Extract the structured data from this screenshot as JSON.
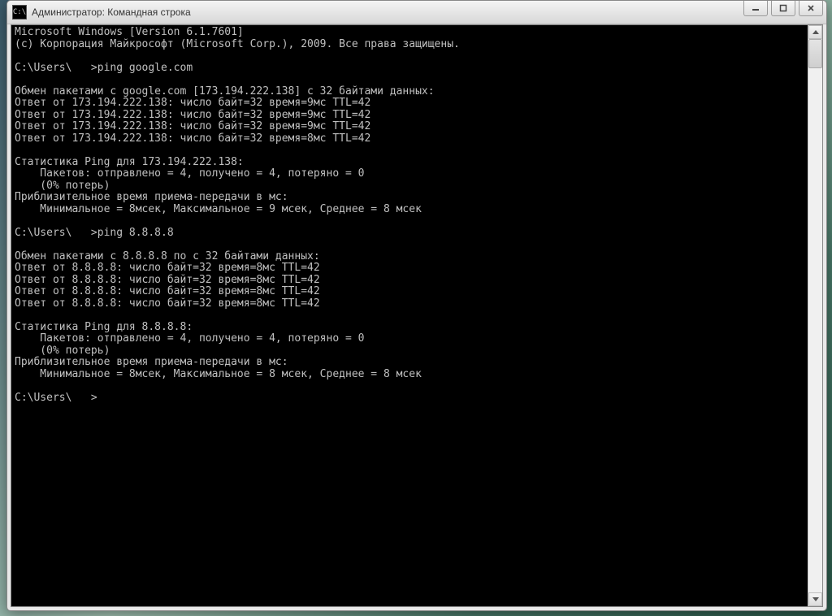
{
  "window": {
    "title": "Администратор: Командная строка",
    "icon_glyph": "C:\\"
  },
  "console": {
    "lines": [
      "Microsoft Windows [Version 6.1.7601]",
      "(c) Корпорация Майкрософт (Microsoft Corp.), 2009. Все права защищены.",
      "",
      "C:\\Users\\   >ping google.com",
      "",
      "Обмен пакетами с google.com [173.194.222.138] с 32 байтами данных:",
      "Ответ от 173.194.222.138: число байт=32 время=9мс TTL=42",
      "Ответ от 173.194.222.138: число байт=32 время=9мс TTL=42",
      "Ответ от 173.194.222.138: число байт=32 время=9мс TTL=42",
      "Ответ от 173.194.222.138: число байт=32 время=8мс TTL=42",
      "",
      "Статистика Ping для 173.194.222.138:",
      "    Пакетов: отправлено = 4, получено = 4, потеряно = 0",
      "    (0% потерь)",
      "Приблизительное время приема-передачи в мс:",
      "    Минимальное = 8мсек, Максимальное = 9 мсек, Среднее = 8 мсек",
      "",
      "C:\\Users\\   >ping 8.8.8.8",
      "",
      "Обмен пакетами с 8.8.8.8 по с 32 байтами данных:",
      "Ответ от 8.8.8.8: число байт=32 время=8мс TTL=42",
      "Ответ от 8.8.8.8: число байт=32 время=8мс TTL=42",
      "Ответ от 8.8.8.8: число байт=32 время=8мс TTL=42",
      "Ответ от 8.8.8.8: число байт=32 время=8мс TTL=42",
      "",
      "Статистика Ping для 8.8.8.8:",
      "    Пакетов: отправлено = 4, получено = 4, потеряно = 0",
      "    (0% потерь)",
      "Приблизительное время приема-передачи в мс:",
      "    Минимальное = 8мсек, Максимальное = 8 мсек, Среднее = 8 мсек",
      "",
      "C:\\Users\\   >"
    ]
  }
}
